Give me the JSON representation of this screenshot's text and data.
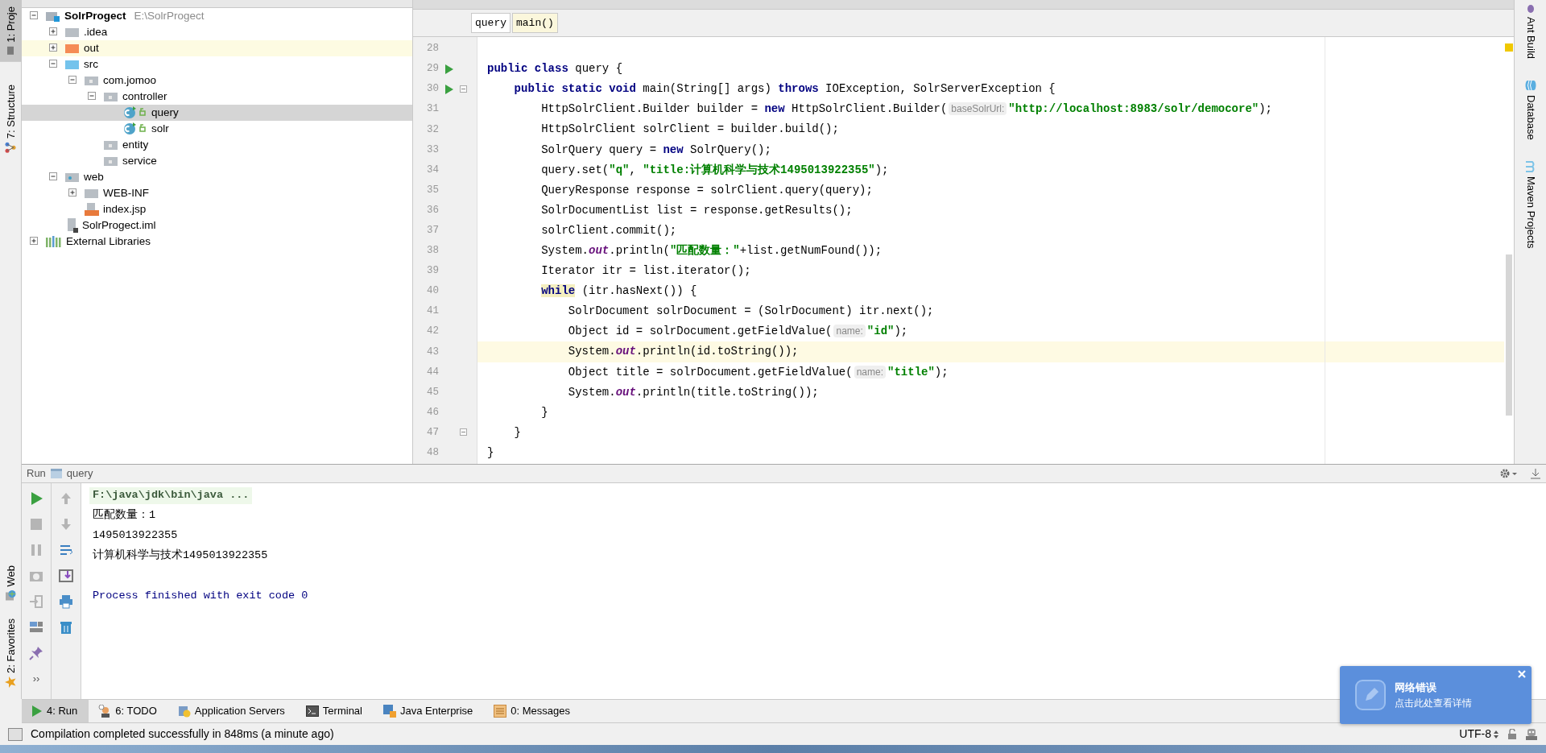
{
  "left_tool_strip": {
    "top": [
      {
        "label": "1: Proje",
        "kind": "project",
        "selected": true
      },
      {
        "label": "7: Structure",
        "kind": "structure",
        "selected": false
      }
    ],
    "bottom": [
      {
        "label": "Web",
        "kind": "web",
        "selected": false
      },
      {
        "label": "2: Favorites",
        "kind": "favorites",
        "selected": false
      }
    ]
  },
  "project_tree": [
    {
      "label": "SolrProgect",
      "path": "E:\\SolrProgect",
      "kind": "module",
      "expanded": true,
      "selected": false,
      "children": [
        {
          "label": ".idea",
          "kind": "folder",
          "expanded": false,
          "selected": false
        },
        {
          "label": "out",
          "kind": "excluded",
          "expanded": false,
          "selected": false
        },
        {
          "label": "src",
          "kind": "source",
          "expanded": true,
          "selected": false,
          "children": [
            {
              "label": "com.jomoo",
              "kind": "package",
              "expanded": true,
              "selected": false,
              "children": [
                {
                  "label": "controller",
                  "kind": "package",
                  "expanded": true,
                  "selected": false,
                  "children": [
                    {
                      "label": "query",
                      "kind": "class",
                      "selected": true
                    },
                    {
                      "label": "solr",
                      "kind": "class",
                      "selected": false
                    }
                  ]
                },
                {
                  "label": "entity",
                  "kind": "package",
                  "selected": false
                },
                {
                  "label": "service",
                  "kind": "package",
                  "selected": false
                }
              ]
            }
          ]
        },
        {
          "label": "web",
          "kind": "web",
          "expanded": true,
          "selected": false,
          "children": [
            {
              "label": "WEB-INF",
              "kind": "folder",
              "expanded": false,
              "selected": false
            },
            {
              "label": "index.jsp",
              "kind": "jsp",
              "selected": false
            }
          ]
        },
        {
          "label": "SolrProgect.iml",
          "kind": "iml",
          "selected": false
        }
      ]
    },
    {
      "label": "External Libraries",
      "kind": "libraries",
      "expanded": false,
      "selected": false
    }
  ],
  "breadcrumbs": [
    {
      "label": "query",
      "selected": false
    },
    {
      "label": "main()",
      "selected": true
    }
  ],
  "code_lines": [
    {
      "number": "28"
    },
    {
      "number": "29",
      "run": true,
      "tokens": [
        {
          "kind": "keyword",
          "t": "public class"
        },
        {
          "kind": "plain",
          "t": " query {"
        }
      ]
    },
    {
      "number": "30",
      "run": true,
      "fold": true,
      "tokens": [
        {
          "kind": "keyword",
          "t": "    public static void"
        },
        {
          "kind": "plain",
          "t": " main(String[] args) "
        },
        {
          "kind": "keyword",
          "t": "throws"
        },
        {
          "kind": "plain",
          "t": " IOException, SolrServerException {"
        }
      ]
    },
    {
      "number": "31",
      "tokens": [
        {
          "kind": "plain",
          "t": "        HttpSolrClient.Builder builder = "
        },
        {
          "kind": "keyword",
          "t": "new"
        },
        {
          "kind": "plain",
          "t": " HttpSolrClient.Builder("
        },
        {
          "kind": "hint",
          "t": "baseSolrUrl:"
        },
        {
          "kind": "string",
          "t": "\"http://localhost:8983/solr/democore\""
        },
        {
          "kind": "plain",
          "t": ");"
        }
      ]
    },
    {
      "number": "32",
      "tokens": [
        {
          "kind": "plain",
          "t": "        HttpSolrClient solrClient = builder.build();"
        }
      ]
    },
    {
      "number": "33",
      "tokens": [
        {
          "kind": "plain",
          "t": "        SolrQuery query = "
        },
        {
          "kind": "keyword",
          "t": "new"
        },
        {
          "kind": "plain",
          "t": " SolrQuery();"
        }
      ]
    },
    {
      "number": "34",
      "tokens": [
        {
          "kind": "plain",
          "t": "        query.set("
        },
        {
          "kind": "string",
          "t": "\"q\""
        },
        {
          "kind": "plain",
          "t": ", "
        },
        {
          "kind": "string",
          "t": "\"title:计算机科学与技术1495013922355\""
        },
        {
          "kind": "plain",
          "t": ");"
        }
      ]
    },
    {
      "number": "35",
      "tokens": [
        {
          "kind": "plain",
          "t": "        QueryResponse response = solrClient.query(query);"
        }
      ]
    },
    {
      "number": "36",
      "tokens": [
        {
          "kind": "plain",
          "t": "        SolrDocumentList list = response.getResults();"
        }
      ]
    },
    {
      "number": "37",
      "tokens": [
        {
          "kind": "plain",
          "t": "        solrClient.commit();"
        }
      ]
    },
    {
      "number": "38",
      "tokens": [
        {
          "kind": "plain",
          "t": "        System."
        },
        {
          "kind": "static",
          "t": "out"
        },
        {
          "kind": "plain",
          "t": ".println("
        },
        {
          "kind": "string",
          "t": "\"匹配数量：\""
        },
        {
          "kind": "plain",
          "t": "+list.getNumFound());"
        }
      ]
    },
    {
      "number": "39",
      "tokens": [
        {
          "kind": "plain",
          "t": "        Iterator itr = list.iterator();"
        }
      ]
    },
    {
      "number": "40",
      "tokens": [
        {
          "kind": "marked",
          "t": "        while"
        },
        {
          "kind": "plain",
          "t": " (itr.hasNext()) {"
        }
      ]
    },
    {
      "number": "41",
      "tokens": [
        {
          "kind": "plain",
          "t": "            SolrDocument solrDocument = (SolrDocument) itr.next();"
        }
      ]
    },
    {
      "number": "42",
      "tokens": [
        {
          "kind": "plain",
          "t": "            Object id = solrDocument.getFieldValue("
        },
        {
          "kind": "hint",
          "t": "name:"
        },
        {
          "kind": "string",
          "t": "\"id\""
        },
        {
          "kind": "plain",
          "t": ");"
        }
      ]
    },
    {
      "number": "43",
      "current": true,
      "tokens": [
        {
          "kind": "plain",
          "t": "            System."
        },
        {
          "kind": "static",
          "t": "out"
        },
        {
          "kind": "plain",
          "t": ".println(id.toString());"
        }
      ]
    },
    {
      "number": "44",
      "tokens": [
        {
          "kind": "plain",
          "t": "            Object title = solrDocument.getFieldValue("
        },
        {
          "kind": "hint",
          "t": "name:"
        },
        {
          "kind": "string",
          "t": "\"title\""
        },
        {
          "kind": "plain",
          "t": ");"
        }
      ]
    },
    {
      "number": "45",
      "tokens": [
        {
          "kind": "plain",
          "t": "            System."
        },
        {
          "kind": "static",
          "t": "out"
        },
        {
          "kind": "plain",
          "t": ".println(title.toString());"
        }
      ]
    },
    {
      "number": "46",
      "tokens": [
        {
          "kind": "plain",
          "t": "        }"
        }
      ]
    },
    {
      "number": "47",
      "fold": true,
      "tokens": [
        {
          "kind": "plain",
          "t": "    }"
        }
      ]
    },
    {
      "number": "48",
      "tokens": [
        {
          "kind": "plain",
          "t": "}"
        }
      ]
    }
  ],
  "right_tool_strip": [
    {
      "label": "Ant Build",
      "kind": "ant"
    },
    {
      "label": "Database",
      "kind": "database"
    },
    {
      "label": "Maven Projects",
      "kind": "maven"
    }
  ],
  "run_panel": {
    "title": "Run",
    "config": "query",
    "toolbar_primary": [
      {
        "kind": "run",
        "disabled": false
      },
      {
        "kind": "stop",
        "disabled": true
      },
      {
        "kind": "pause",
        "disabled": true
      },
      {
        "kind": "camera",
        "disabled": true
      },
      {
        "kind": "exit",
        "disabled": true
      },
      {
        "kind": "layout",
        "disabled": false
      },
      {
        "kind": "pin",
        "disabled": false
      },
      {
        "kind": "more",
        "label": "››"
      }
    ],
    "toolbar_secondary": [
      {
        "kind": "up",
        "disabled": true
      },
      {
        "kind": "down",
        "disabled": true
      },
      {
        "kind": "wrap",
        "disabled": false
      },
      {
        "kind": "scroll",
        "disabled": false
      },
      {
        "kind": "print",
        "disabled": false
      },
      {
        "kind": "trash",
        "disabled": false
      }
    ],
    "console": [
      {
        "kind": "command",
        "text": "F:\\java\\jdk\\bin\\java ..."
      },
      {
        "kind": "output",
        "text": "匹配数量：1"
      },
      {
        "kind": "output",
        "text": "1495013922355"
      },
      {
        "kind": "output",
        "text": "计算机科学与技术1495013922355"
      },
      {
        "kind": "blank"
      },
      {
        "kind": "system",
        "text": "Process finished with exit code 0"
      }
    ]
  },
  "bottom_tabs": [
    {
      "label": "4: Run",
      "kind": "run",
      "selected": true
    },
    {
      "label": "6: TODO",
      "kind": "todo",
      "selected": false
    },
    {
      "label": "Application Servers",
      "kind": "servers",
      "selected": false
    },
    {
      "label": "Terminal",
      "kind": "terminal",
      "selected": false
    },
    {
      "label": "Java Enterprise",
      "kind": "enterprise",
      "selected": false
    },
    {
      "label": "0: Messages",
      "kind": "messages",
      "selected": false
    }
  ],
  "status_bar": {
    "message": "Compilation completed successfully in 848ms (a minute ago)",
    "encoding": "UTF-8"
  },
  "notification": {
    "title": "网络错误",
    "body": "点击此处查看详情"
  }
}
